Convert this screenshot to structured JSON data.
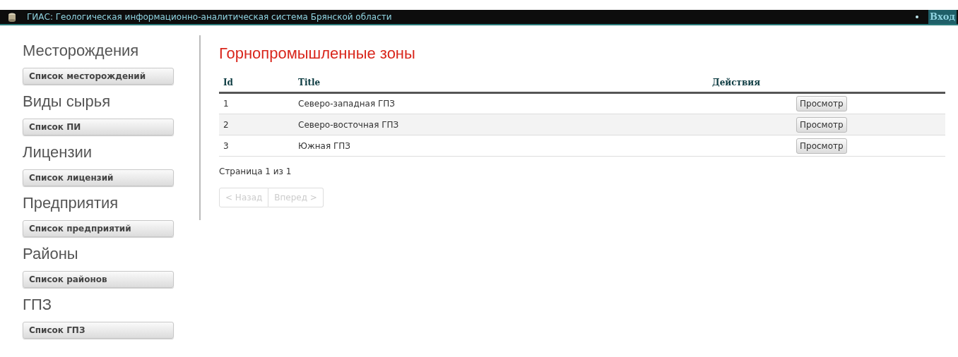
{
  "header": {
    "title": "ГИАС: Геологическая информационно-аналитическая система Брянской области",
    "login_link": "Вход"
  },
  "sidebar": {
    "sections": [
      {
        "heading": "Месторождения",
        "button": "Список месторождений"
      },
      {
        "heading": "Виды сырья",
        "button": "Список ПИ"
      },
      {
        "heading": "Лицензии",
        "button": "Список лицензий"
      },
      {
        "heading": "Предприятия",
        "button": "Список предприятий"
      },
      {
        "heading": "Районы",
        "button": "Список районов"
      },
      {
        "heading": "ГПЗ",
        "button": "Список ГПЗ"
      }
    ]
  },
  "page_title": "Горнопромышленные зоны",
  "table": {
    "columns": [
      "Id",
      "Title",
      "Действия"
    ],
    "rows": [
      {
        "id": "1",
        "title": "Северо-западная ГПЗ",
        "action": "Просмотр"
      },
      {
        "id": "2",
        "title": "Северо-восточная ГПЗ",
        "action": "Просмотр"
      },
      {
        "id": "3",
        "title": "Южная ГПЗ",
        "action": "Просмотр"
      }
    ]
  },
  "pagination": {
    "info": "Страница 1 из 1",
    "buttons": [
      {
        "label": "< Назад",
        "disabled": true
      },
      {
        "label": "Вперед >",
        "disabled": true
      }
    ]
  }
}
